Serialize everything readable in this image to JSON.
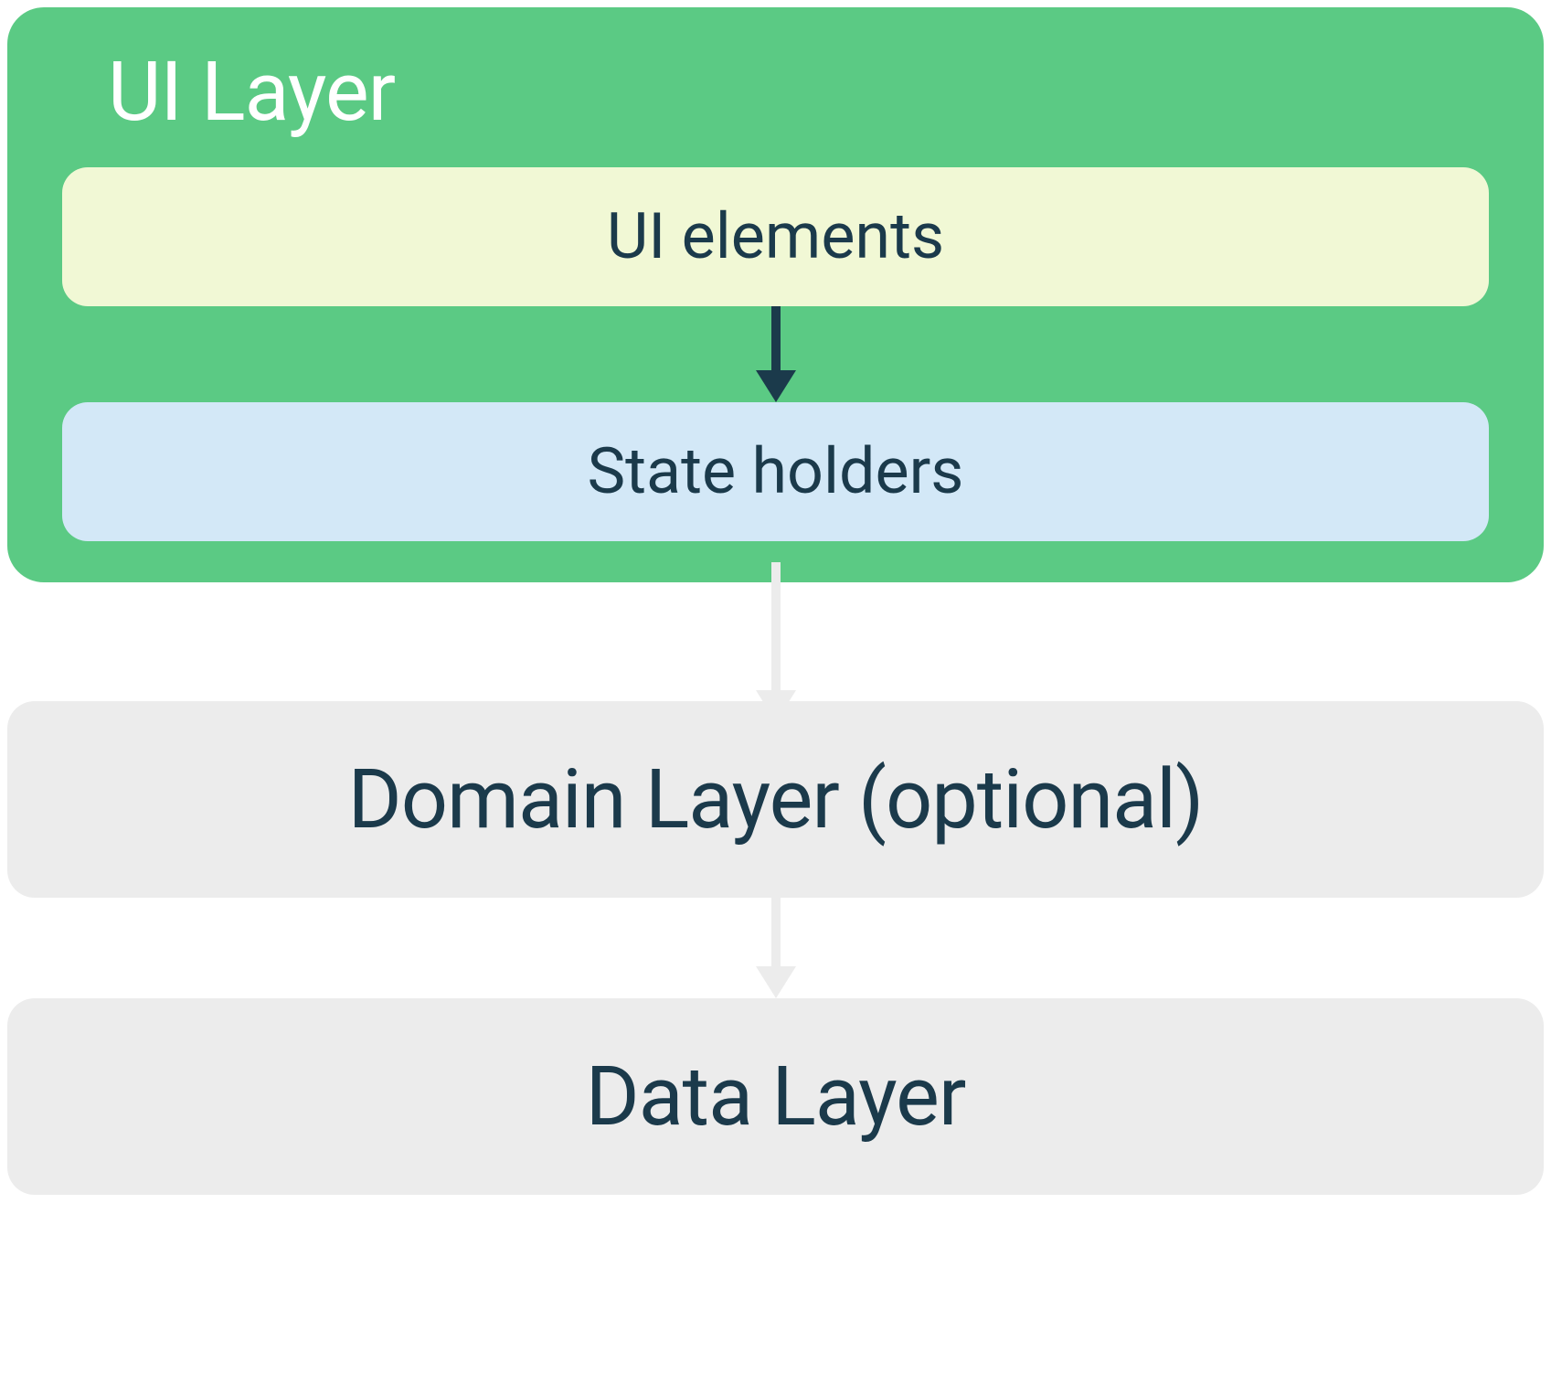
{
  "ui_layer": {
    "title": "UI Layer",
    "ui_elements_label": "UI elements",
    "state_holders_label": "State holders"
  },
  "domain_layer": {
    "label": "Domain Layer (optional)"
  },
  "data_layer": {
    "label": "Data Layer"
  },
  "colors": {
    "ui_layer_bg": "#5BCA84",
    "ui_elements_bg": "#F1F8D5",
    "state_holders_bg": "#D3E8F7",
    "outer_box_bg": "#ECECEC",
    "text_dark": "#1B3A4B",
    "text_white": "#FFFFFF",
    "arrow_dark": "#1B3A4B",
    "arrow_light": "#ECECEC"
  }
}
